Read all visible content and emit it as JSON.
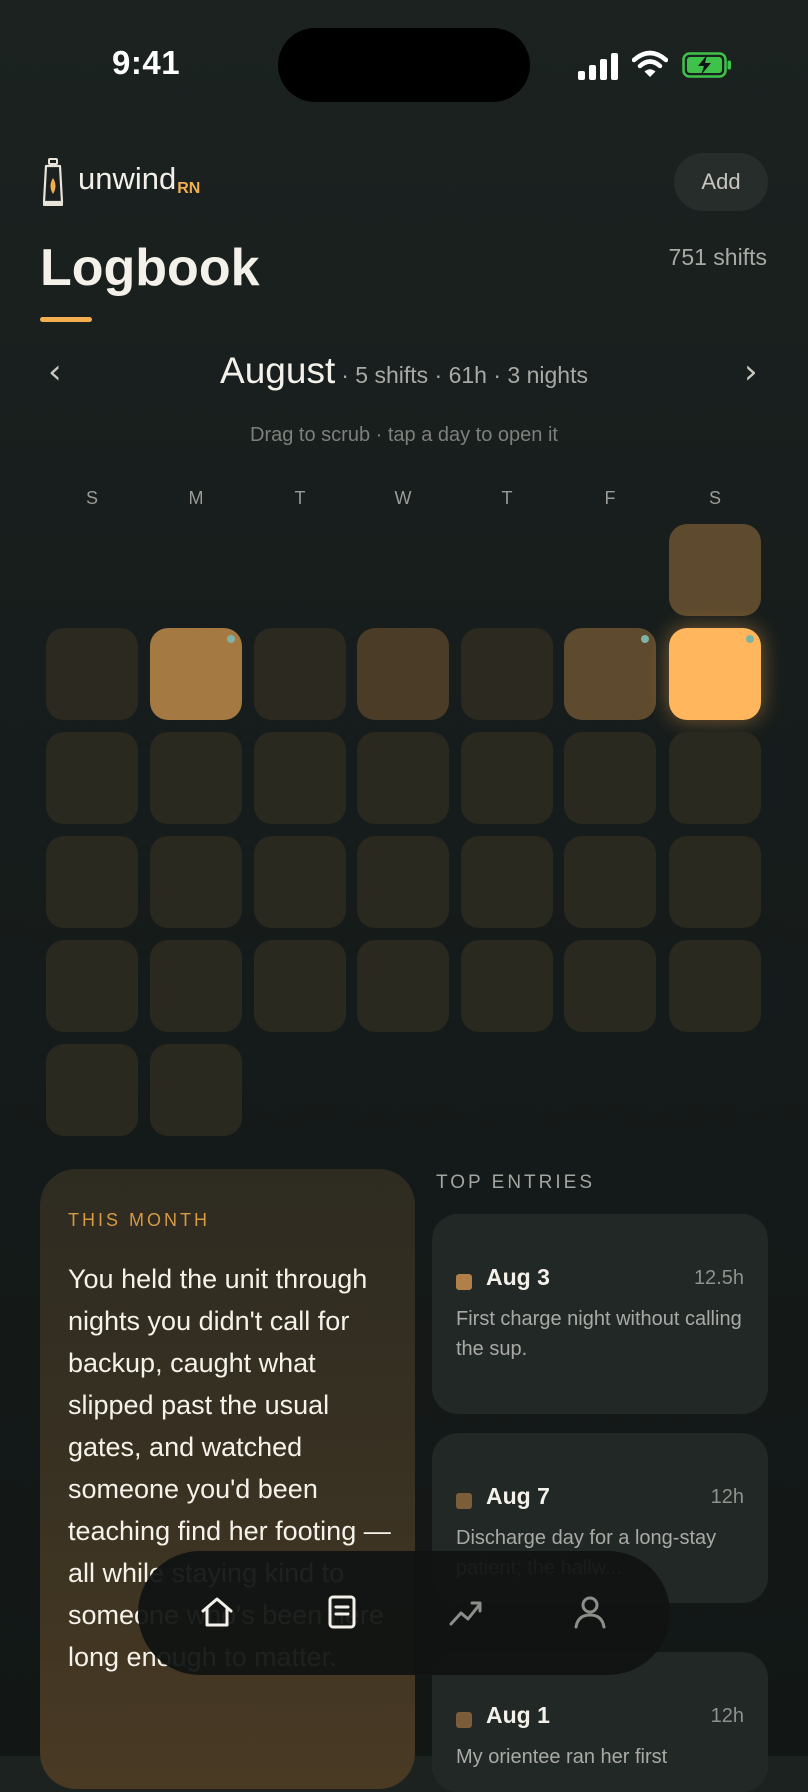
{
  "status_bar": {
    "time": "9:41"
  },
  "header": {
    "brand": "unwind",
    "brand_suffix": "RN",
    "add_label": "Add",
    "title": "Logbook",
    "shift_count": "751 shifts"
  },
  "month_nav": {
    "prev": "‹",
    "next": "›",
    "month": "August",
    "stats": "· 5 shifts · 61h · 3 nights",
    "hint": "Drag to scrub · tap a day to open it"
  },
  "weekdays": [
    "S",
    "M",
    "T",
    "W",
    "T",
    "F",
    "S"
  ],
  "this_month": {
    "label": "THIS MONTH",
    "text": "You held the unit through nights you didn't call for backup, caught what slipped past the usual gates, and watched someone you'd been teaching find her footing — all while staying kind to someone who's been here long enough to matter."
  },
  "top_entries": {
    "label": "TOP ENTRIES",
    "items": [
      {
        "date": "Aug 3",
        "hours": "12.5h",
        "desc": "First charge night without calling the sup."
      },
      {
        "date": "Aug 7",
        "hours": "12h",
        "desc": "Discharge day for a long-stay patient; the hallw..."
      },
      {
        "date": "Aug 1",
        "hours": "12h",
        "desc": "My orientee ran her first"
      }
    ]
  },
  "tabs": [
    "home-icon",
    "logbook-icon",
    "trends-icon",
    "profile-icon"
  ],
  "colors": {
    "accent": "#f2ae4f",
    "night_dot": "#7fb3a5",
    "background": "#171d1c"
  }
}
